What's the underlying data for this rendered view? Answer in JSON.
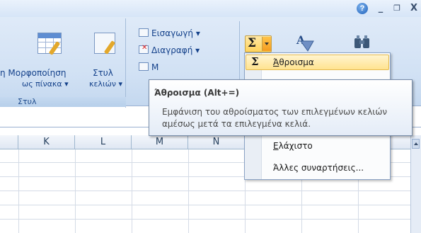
{
  "titlebar": {
    "help_icon": "?",
    "minimize_icon": "_",
    "restore_icon": "❐",
    "close_icon": "X"
  },
  "ribbon": {
    "styles_group": {
      "format_as_table_line1": "η Μορφοποίηση",
      "format_as_table_line2": "ως πίνακα ▾",
      "cell_styles_line1": "Στυλ",
      "cell_styles_line2": "κελιών ▾",
      "group_label": "Στυλ"
    },
    "cells_group": {
      "insert": "Εισαγωγή ▾",
      "delete": "Διαγραφή ▾",
      "format": "Μ"
    },
    "editing_group": {
      "sum_icon": "Σ"
    }
  },
  "menu": {
    "items": [
      {
        "label": "Άθροισμα",
        "selected": true,
        "icon": "Σ"
      },
      {
        "label": "Ελάχιστο",
        "selected": false
      },
      {
        "label": "Άλλες συναρτήσεις...",
        "selected": false
      }
    ]
  },
  "tooltip": {
    "title": "Άθροισμα (Alt+=)",
    "body": "Εμφάνιση του αθροίσματος των επιλεγμένων κελιών αμέσως μετά τα επιλεγμένα κελιά."
  },
  "sheet": {
    "columns": [
      "K",
      "L",
      "M",
      "N"
    ]
  },
  "colors": {
    "ribbon_bg": "#d1e1f4",
    "highlight": "#ffe38f",
    "text_blue": "#15428b"
  }
}
